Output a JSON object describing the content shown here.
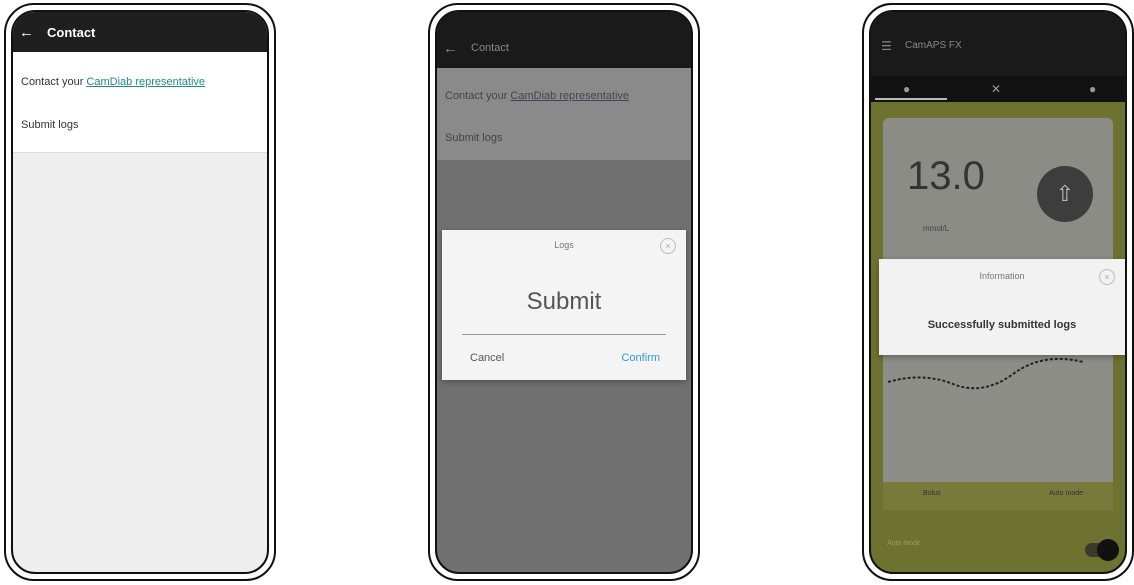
{
  "phone1": {
    "title": "Contact",
    "contact_prefix": "Contact your ",
    "contact_link": "CamDiab representative",
    "submit_logs": "Submit logs"
  },
  "phone2": {
    "title": "Contact",
    "contact_prefix": "Contact your ",
    "contact_link": "CamDiab representative",
    "submit_logs": "Submit logs",
    "dialog": {
      "title": "Logs",
      "main": "Submit",
      "cancel": "Cancel",
      "confirm": "Confirm"
    }
  },
  "phone3": {
    "title": "CamAPS FX",
    "reading": "13.0",
    "unit": "mmol/L",
    "dialog": {
      "title": "Information",
      "message": "Successfully submitted logs"
    },
    "bottom": {
      "left": "Bolus",
      "right": "Auto mode"
    },
    "toggle_label": "Auto mode"
  }
}
